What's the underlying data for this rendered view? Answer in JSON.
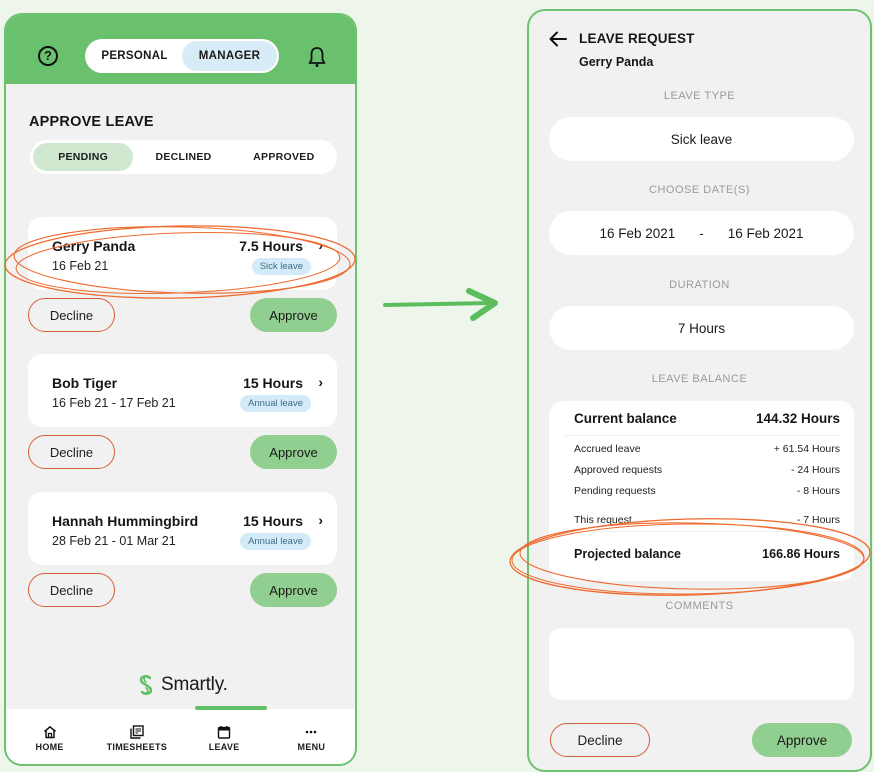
{
  "colors": {
    "brand_green": "#69c06d",
    "approve_green": "#90cf8f",
    "decline_orange": "#d4603a",
    "badge_blue": "#d3ebf8",
    "annotation_orange": "#ef6a2e"
  },
  "left": {
    "header": {
      "help_icon": "help-circle-icon",
      "role_toggle": {
        "options": [
          "PERSONAL",
          "MANAGER"
        ],
        "selected": "MANAGER"
      },
      "bell_icon": "bell-icon"
    },
    "title": "APPROVE LEAVE",
    "status_tabs": {
      "items": [
        "PENDING",
        "DECLINED",
        "APPROVED"
      ],
      "selected": "PENDING"
    },
    "requests": [
      {
        "name": "Gerry Panda",
        "dates": "16 Feb 21",
        "hours": "7.5 Hours",
        "type": "Sick leave",
        "decline": "Decline",
        "approve": "Approve",
        "highlighted": true
      },
      {
        "name": "Bob Tiger",
        "dates": "16 Feb 21 - 17 Feb 21",
        "hours": "15 Hours",
        "type": "Annual leave",
        "decline": "Decline",
        "approve": "Approve",
        "highlighted": false
      },
      {
        "name": "Hannah Hummingbird",
        "dates": "28 Feb 21 - 01 Mar 21",
        "hours": "15 Hours",
        "type": "Annual leave",
        "decline": "Decline",
        "approve": "Approve",
        "highlighted": false
      }
    ],
    "brand": "Smartly.",
    "nav": {
      "items": [
        {
          "label": "HOME",
          "icon": "home-icon"
        },
        {
          "label": "TIMESHEETS",
          "icon": "timesheets-icon"
        },
        {
          "label": "LEAVE",
          "icon": "calendar-icon"
        },
        {
          "label": "MENU",
          "icon": "more-icon"
        }
      ],
      "active": "LEAVE"
    }
  },
  "right": {
    "title": "LEAVE REQUEST",
    "employee": "Gerry Panda",
    "leave_type": {
      "label": "LEAVE TYPE",
      "value": "Sick leave"
    },
    "dates": {
      "label": "CHOOSE DATE(S)",
      "from": "16 Feb 2021",
      "separator": "-",
      "to": "16 Feb 2021"
    },
    "duration": {
      "label": "DURATION",
      "value": "7 Hours"
    },
    "balance": {
      "label": "LEAVE BALANCE",
      "current": {
        "label": "Current balance",
        "value": "144.32 Hours"
      },
      "lines": [
        {
          "label": "Accrued leave",
          "value": "+ 61.54 Hours"
        },
        {
          "label": "Approved requests",
          "value": "- 24 Hours"
        },
        {
          "label": "Pending requests",
          "value": "- 8 Hours"
        },
        {
          "label": "This request",
          "value": "- 7 Hours"
        }
      ],
      "projected": {
        "label": "Projected balance",
        "value": "166.86 Hours"
      }
    },
    "comments": {
      "label": "COMMENTS",
      "value": ""
    },
    "decline": "Decline",
    "approve": "Approve"
  }
}
